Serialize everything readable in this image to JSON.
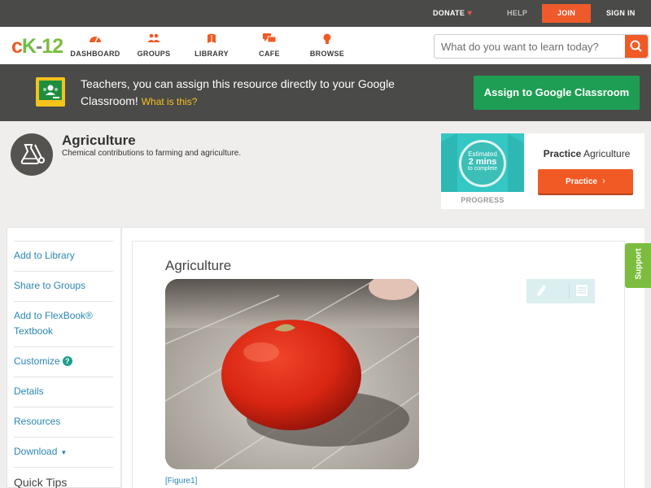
{
  "topbar": {
    "donate": "DONATE",
    "help": "HELP",
    "join": "JOIN",
    "signin": "SIGN IN"
  },
  "logo": {
    "c": "c",
    "k": "K",
    "dash": "-",
    "num": "12"
  },
  "nav": {
    "dashboard": "DASHBOARD",
    "groups": "GROUPS",
    "library": "LIBRARY",
    "cafe": "CAFE",
    "browse": "BROWSE"
  },
  "search": {
    "placeholder": "What do you want to learn today?"
  },
  "classroom_banner": {
    "text": "Teachers, you can assign this resource directly to your Google Classroom!",
    "what_link": "What is this?",
    "button": "Assign to Google Classroom"
  },
  "topic": {
    "title": "Agriculture",
    "subtitle": "Chemical contributions to farming and agriculture."
  },
  "practice": {
    "estimated": "Estimated",
    "mins": "2 mins",
    "to_complete": "to complete",
    "progress_label": "PROGRESS",
    "title_bold": "Practice",
    "title_rest": "Agriculture",
    "button": "Practice"
  },
  "sidebar": {
    "items": [
      {
        "label": "Add to Library"
      },
      {
        "label": "Share to Groups"
      },
      {
        "label": "Add to FlexBook® Textbook"
      },
      {
        "label": "Customize"
      },
      {
        "label": "Details"
      },
      {
        "label": "Resources"
      },
      {
        "label": "Download"
      },
      {
        "label": "Quick Tips"
      }
    ]
  },
  "article": {
    "title": "Agriculture",
    "figure_link": "[Figure1]"
  },
  "support": {
    "label": "Support"
  },
  "colors": {
    "brand_orange": "#f15a24",
    "brand_green": "#7cbd3f",
    "classroom_green": "#1e9e54",
    "link_blue": "#2a87b4",
    "dark_bar": "#4a4a48"
  }
}
